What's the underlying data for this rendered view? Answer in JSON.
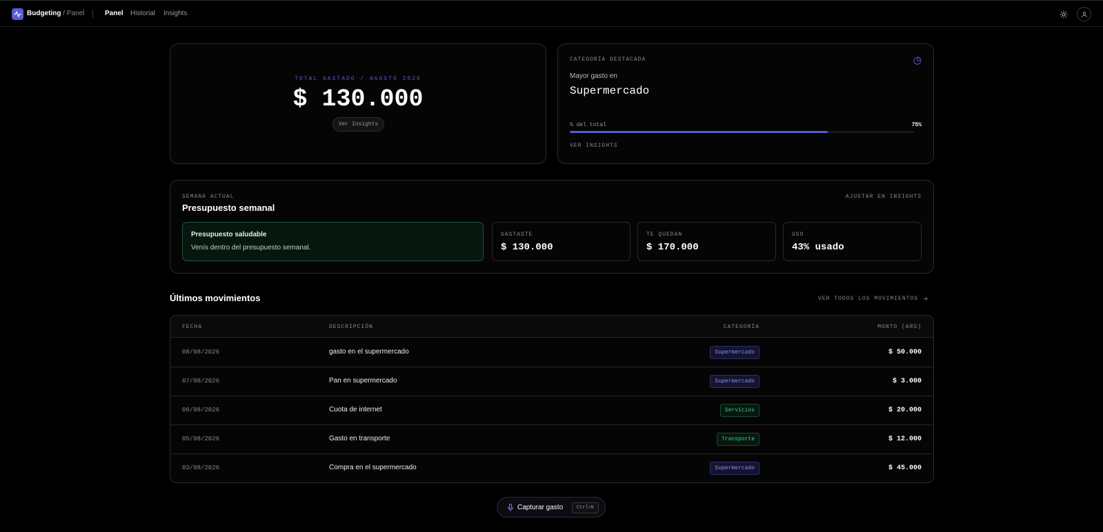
{
  "header": {
    "brand": "Budgeting",
    "separator": "/",
    "crumb": "Panel",
    "nav": [
      {
        "label": "Panel",
        "active": true
      },
      {
        "label": "Historial",
        "active": false
      },
      {
        "label": "Insights",
        "active": false
      }
    ],
    "icons": {
      "logo": "activity-icon",
      "theme": "sun-icon",
      "user": "user-icon"
    }
  },
  "total_card": {
    "label": "TOTAL GASTADO / AGOSTO 2026",
    "value": "$ 130.000",
    "button": "Ver Insights"
  },
  "category_card": {
    "label": "CATEGORÍA DESTACADA",
    "icon": "pie-chart-icon",
    "subtitle": "Mayor gasto en",
    "name": "Supermercado",
    "pct_label": "% del total",
    "pct_value": "75%",
    "pct_fraction": 0.75,
    "link": "VER INSIGHTS"
  },
  "weekly": {
    "label": "SEMANA ACTUAL",
    "title": "Presupuesto semanal",
    "adjust": "AJUSTAR EN INSIGHTS",
    "health_title": "Presupuesto saludable",
    "health_text": "Venís dentro del presupuesto semanal.",
    "stats": [
      {
        "label": "GASTASTE",
        "value": "$ 130.000"
      },
      {
        "label": "TE QUEDAN",
        "value": "$ 170.000"
      },
      {
        "label": "USO",
        "value": "43% usado"
      }
    ]
  },
  "movements": {
    "title": "Últimos movimientos",
    "link": "VER TODOS LOS MOVIMIENTOS",
    "columns": [
      "FECHA",
      "DESCRIPCIÓN",
      "CATEGORÍA",
      "MONTO (ARS)"
    ],
    "rows": [
      {
        "date": "08/08/2026",
        "desc": "gasto en el supermercado",
        "cat": "Supermercado",
        "amount": "$ 50.000"
      },
      {
        "date": "07/08/2026",
        "desc": "Pan en supermercado",
        "cat": "Supermercado",
        "amount": "$ 3.000"
      },
      {
        "date": "06/08/2026",
        "desc": "Cuota de internet",
        "cat": "Servicios",
        "amount": "$ 20.000"
      },
      {
        "date": "05/08/2026",
        "desc": "Gasto en transporte",
        "cat": "Transporte",
        "amount": "$ 12.000"
      },
      {
        "date": "03/08/2026",
        "desc": "Compra en el supermercado",
        "cat": "Supermercado",
        "amount": "$ 45.000"
      }
    ]
  },
  "capture": {
    "label": "Capturar gasto",
    "shortcut": "Ctrl+K",
    "icon": "microphone-icon"
  },
  "colors": {
    "accent": "#5b5bd6",
    "background": "#000000",
    "success": "#3fd083"
  }
}
